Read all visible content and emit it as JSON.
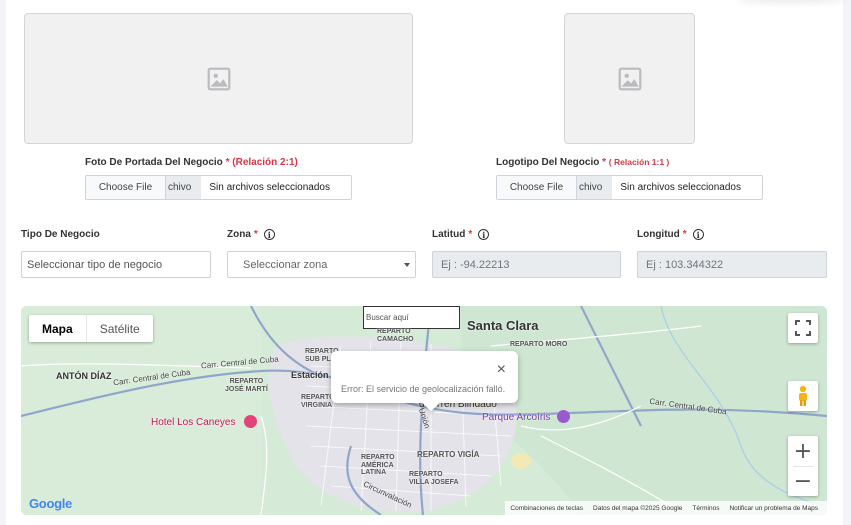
{
  "uploads": {
    "cover": {
      "label": "Foto De Portada Del Negocio",
      "required": "*",
      "ratio": "(Relación 2:1)",
      "choose_button": "Choose File",
      "choose_tail": "chivo",
      "file_status": "Sin archivos seleccionados"
    },
    "logo": {
      "label": "Logotipo Del Negocio",
      "required": "*",
      "ratio": "( Relación 1:1 )",
      "choose_button": "Choose File",
      "choose_tail": "chivo",
      "file_status": "Sin archivos seleccionados"
    }
  },
  "fields": {
    "tipo": {
      "label": "Tipo De Negocio",
      "placeholder": "Seleccionar tipo de negocio"
    },
    "zona": {
      "label": "Zona",
      "required": "*",
      "placeholder": "Seleccionar zona"
    },
    "latitud": {
      "label": "Latitud",
      "required": "*",
      "placeholder": "Ej : -94.22213"
    },
    "longitud": {
      "label": "Longitud",
      "required": "*",
      "placeholder": "Ej : 103.344322"
    }
  },
  "map": {
    "type_controls": {
      "map": "Mapa",
      "satellite": "Satélite"
    },
    "search_placeholder": "Buscar aquí",
    "error_message": "Error: El servicio de geolocalización falló.",
    "zoom_in": "+",
    "zoom_out": "−",
    "close": "×",
    "places": {
      "santa_clara": "Santa Clara",
      "anton_diaz": "ANTÓN DÍAZ",
      "reparto_jose_marti": "REPARTO\nJOSÉ MARTÍ",
      "reparto_virginia": "REPARTO\nVIRGINIA",
      "reparto_sub_pl": "REPARTO\nSUB PL",
      "reparto_camacho": "REPARTO\nCAMACHO",
      "estacion": "Estación",
      "reparto_moro": "REPARTO MORO",
      "hotel": "Hotel Los Caneyes",
      "tren_blindado": "del Tren Blindado",
      "parque": "Parque Arcoíris",
      "reparto_vigia": "REPARTO VIGÍA",
      "reparto_america_latina": "REPARTO\nAMÉRICA\nLATINA",
      "reparto_villa_josefa": "REPARTO\nVILLA JOSEFA",
      "union": "Unión",
      "carr_central_1": "Carr. Central de Cuba",
      "carr_central_2": "Carr. Central de Cuba",
      "carr_central_3": "Carr. Central de Cuba",
      "circunvalacion": "Circunvalación"
    },
    "footer": {
      "shortcuts": "Combinaciones de teclas",
      "data": "Datos del mapa ©2025 Google",
      "terms": "Términos",
      "report": "Notificar un problema de Maps"
    },
    "logo": "Google"
  }
}
